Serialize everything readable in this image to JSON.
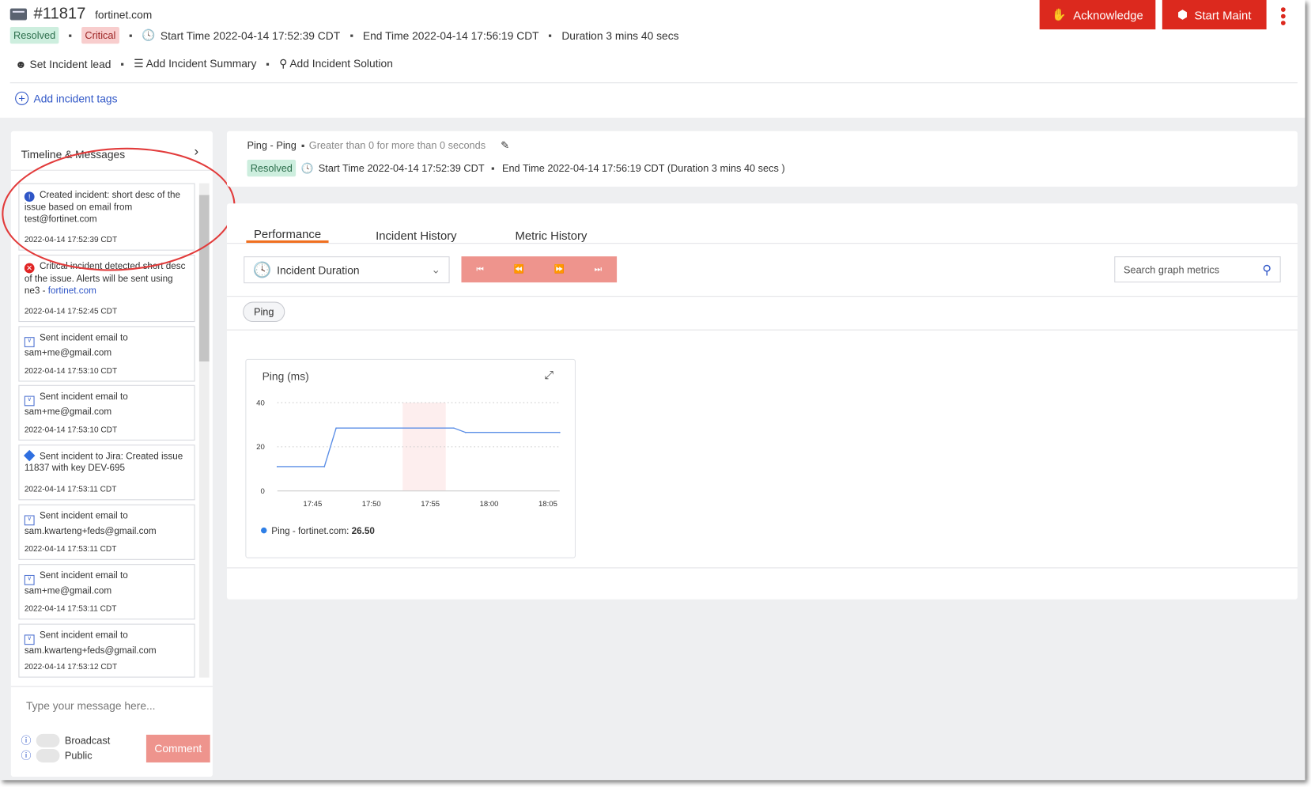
{
  "header": {
    "incident_id": "#11817",
    "host": "fortinet.com",
    "status": "Resolved",
    "severity": "Critical",
    "start_time": "Start Time 2022-04-14 17:52:39 CDT",
    "end_time": "End Time 2022-04-14 17:56:19 CDT",
    "duration": "Duration 3 mins 40 secs",
    "actions": {
      "lead": "Set Incident lead",
      "summary": "Add Incident Summary",
      "solution": "Add Incident Solution"
    },
    "add_tags": "Add incident tags",
    "acknowledge": "Acknowledge",
    "start_maint": "Start Maint"
  },
  "timeline": {
    "title": "Timeline & Messages",
    "items": [
      {
        "icon": "info-icon",
        "text": "Created incident: short desc of the issue based on email from test@fortinet.com",
        "link": "",
        "time": "2022-04-14 17:52:39 CDT"
      },
      {
        "icon": "error-icon",
        "text": "Critical incident detected short desc of the issue. Alerts will be sent using ne3 - ",
        "link": "fortinet.com",
        "time": "2022-04-14 17:52:45 CDT"
      },
      {
        "icon": "mail-icon",
        "text": "Sent incident email to sam+me@gmail.com",
        "link": "",
        "time": "2022-04-14 17:53:10 CDT"
      },
      {
        "icon": "mail-icon",
        "text": "Sent incident email to sam+me@gmail.com",
        "link": "",
        "time": "2022-04-14 17:53:10 CDT"
      },
      {
        "icon": "jira-icon",
        "text": "Sent incident to Jira: Created issue 11837 with key DEV-695",
        "link": "",
        "time": "2022-04-14 17:53:11 CDT"
      },
      {
        "icon": "mail-icon",
        "text": "Sent incident email to sam.kwarteng+feds@gmail.com",
        "link": "",
        "time": "2022-04-14 17:53:11 CDT"
      },
      {
        "icon": "mail-icon",
        "text": "Sent incident email to sam+me@gmail.com",
        "link": "",
        "time": "2022-04-14 17:53:11 CDT"
      },
      {
        "icon": "mail-icon",
        "text": "Sent incident email to sam.kwarteng+feds@gmail.com",
        "link": "",
        "time": "2022-04-14 17:53:12 CDT"
      }
    ],
    "message_placeholder": "Type your message here...",
    "broadcast": "Broadcast",
    "public": "Public",
    "comment": "Comment"
  },
  "metric": {
    "name": "Ping - Ping",
    "condition": "Greater than 0 for more than 0 seconds",
    "status": "Resolved",
    "start_time": "Start Time 2022-04-14 17:52:39 CDT",
    "end_time": "End Time 2022-04-14 17:56:19 CDT (Duration 3 mins 40 secs )"
  },
  "tabs": [
    "Performance",
    "Incident History",
    "Metric History"
  ],
  "controls": {
    "range": "Incident Duration",
    "search_placeholder": "Search graph metrics",
    "chip": "Ping"
  },
  "colors": {
    "accent": "#dc291e",
    "tab_underline": "#f07020",
    "line": "#5b8ee6",
    "band": "#fdeeee"
  },
  "chart_data": {
    "type": "line",
    "title": "Ping (ms)",
    "x": [
      "17:42",
      "17:46",
      "17:47",
      "17:57",
      "17:58",
      "18:06"
    ],
    "x_minutes": [
      0,
      4,
      5,
      15,
      16,
      24
    ],
    "series": [
      {
        "name": "Ping - fortinet.com",
        "values": [
          11,
          11,
          28.5,
          28.5,
          26.5,
          26.5
        ]
      }
    ],
    "legend_value": "26.50",
    "xticks": [
      "17:45",
      "17:50",
      "17:55",
      "18:00",
      "18:05"
    ],
    "xtick_minutes": [
      3,
      8,
      13,
      18,
      23
    ],
    "yticks": [
      "0",
      "20",
      "40"
    ],
    "ylim": [
      0,
      40
    ],
    "incident_band_minutes": [
      10.65,
      14.32
    ],
    "grid": true,
    "legend": "bottom-left"
  }
}
